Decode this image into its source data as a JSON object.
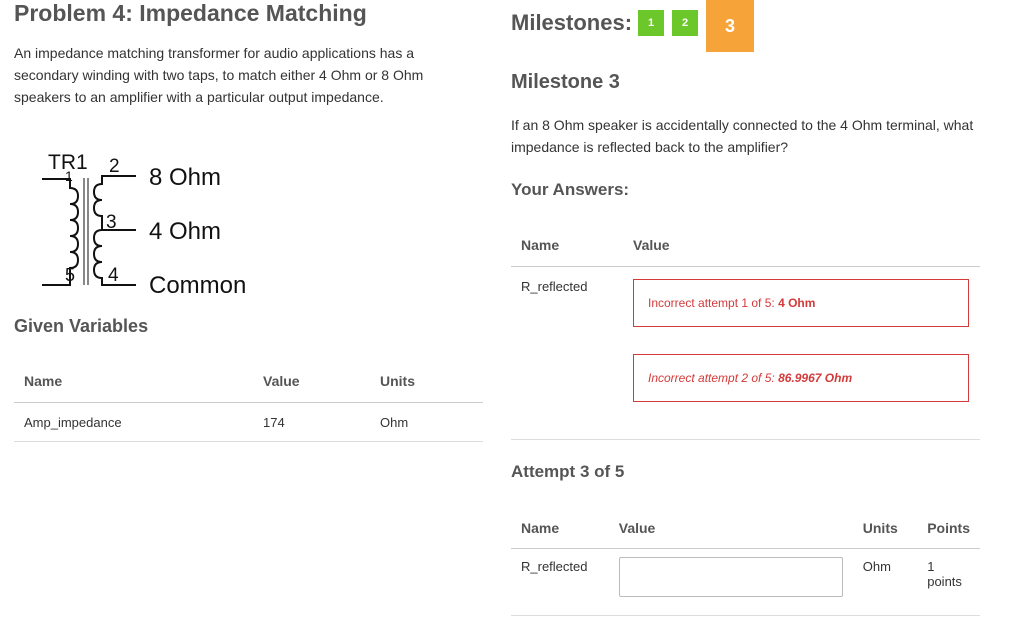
{
  "problem": {
    "title": "Problem 4: Impedance Matching",
    "description": "An impedance matching transformer for audio applications has a secondary winding with two taps, to match either 4 Ohm or 8 Ohm speakers to an amplifier with a particular output impedance."
  },
  "circuit": {
    "ref": "TR1",
    "pins": {
      "p1": "1",
      "p2": "2",
      "p3": "3",
      "p4": "4",
      "p5": "5"
    },
    "tap_labels": [
      "8 Ohm",
      "4 Ohm",
      "Common"
    ]
  },
  "given": {
    "title": "Given Variables",
    "headers": [
      "Name",
      "Value",
      "Units"
    ],
    "rows": [
      {
        "name": "Amp_impedance",
        "value": "174",
        "units": "Ohm"
      }
    ]
  },
  "milestones": {
    "label": "Milestones:",
    "items": [
      "1",
      "2",
      "3"
    ],
    "colors": {
      "done": "#6cc72b",
      "current": "#f6a43a"
    }
  },
  "milestone": {
    "title": "Milestone 3",
    "question": "If an 8 Ohm speaker is accidentally connected to the 4 Ohm terminal, what impedance is reflected back to the amplifier?"
  },
  "answers": {
    "title": "Your Answers:",
    "headers": [
      "Name",
      "Value"
    ],
    "row_name": "R_reflected",
    "attempts": [
      {
        "prefix": "Incorrect attempt 1 of 5: ",
        "value": "4 Ohm"
      },
      {
        "prefix": "Incorrect attempt 2 of 5: ",
        "value": "86.9967 Ohm"
      }
    ],
    "error_color": "#d33a3a"
  },
  "attempt": {
    "title": "Attempt 3 of 5",
    "headers": [
      "Name",
      "Value",
      "Units",
      "Points"
    ],
    "row": {
      "name": "R_reflected",
      "value": "",
      "units": "Ohm",
      "points": "1 points"
    }
  }
}
